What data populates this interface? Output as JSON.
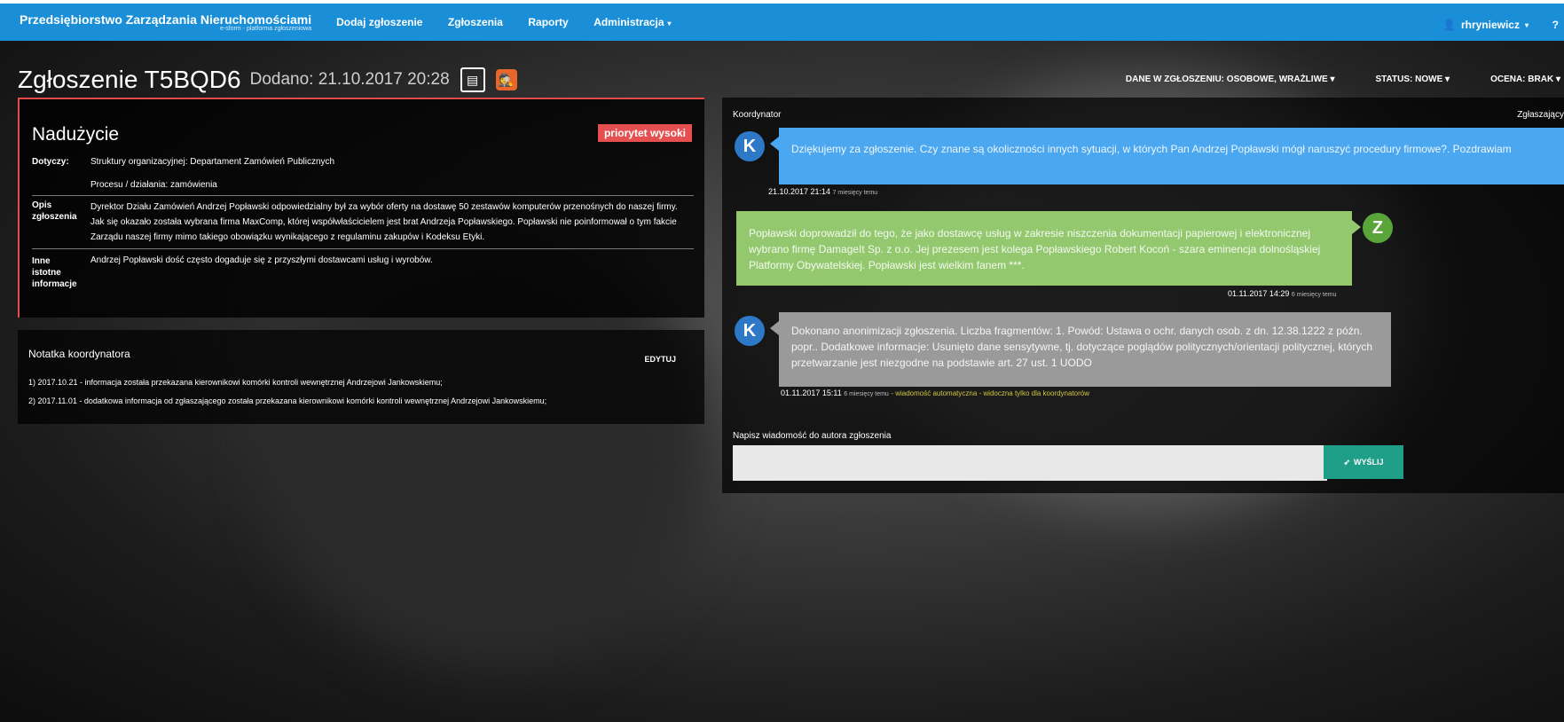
{
  "nav": {
    "brand_title": "Przedsiębiorstwo Zarządzania Nieruchomościami",
    "brand_sub": "e-sform - platforma zgłoszeniowa",
    "items": [
      "Dodaj zgłoszenie",
      "Zgłoszenia",
      "Raporty",
      "Administracja"
    ],
    "user": "rhryniewicz",
    "help": "?"
  },
  "header": {
    "title": "Zgłoszenie T5BQD6",
    "added": "Dodano: 21.10.2017 20:28",
    "data_label": "DANE W ZGŁOSZENIU:",
    "data_value": "OSOBOWE, WRAŻLIWE",
    "status_label": "STATUS:",
    "status_value": "NOWE",
    "rating_label": "OCENA:",
    "rating_value": "BRAK"
  },
  "case": {
    "category": "Nadużycie",
    "priority": "priorytet wysoki",
    "concerns_label": "Dotyczy:",
    "structure": "Struktury organizacyjnej:  Departament Zamówień Publicznych",
    "process": "Procesu / działania:  zamówienia",
    "desc_label_1": "Opis",
    "desc_label_2": "zgłoszenia",
    "description": "Dyrektor Działu Zamówień Andrzej Popławski odpowiedzialny był za wybór oferty na dostawę 50 zestawów komputerów przenośnych do naszej firmy. Jak się okazało została wybrana firma MaxComp, której współwłaścicielem jest brat Andrzeja Popławskiego. Popławski nie poinformował o tym fakcie Zarządu naszej firmy mimo takiego obowiązku wynikającego z regulaminu zakupów i Kodeksu Etyki.",
    "other_label_1": "Inne",
    "other_label_2": "istotne",
    "other_label_3": "informacje",
    "other": "Andrzej Popławski dość często dogaduje się z przyszłymi dostawcami usług i wyrobów."
  },
  "note": {
    "title": "Notatka koordynatora",
    "edit": "EDYTUJ",
    "lines": [
      "1) 2017.10.21 - informacja została przekazana kierownikowi komórki kontroli wewnętrznej Andrzejowi Jankowskiemu;",
      "2) 2017.11.01 - dodatkowa informacja od zgłaszającego została przekazana kierownikowi komórki kontroli wewnętrznej Andrzejowi Jankowskiemu;"
    ]
  },
  "chat": {
    "left_label": "Koordynator",
    "right_label": "Zgłaszający",
    "messages": [
      {
        "avatar": "K",
        "text": "Dziękujemy za zgłoszenie. Czy znane są okoliczności innych sytuacji, w których Pan Andrzej Popławski mógł naruszyć procedury firmowe?. Pozdrawiam",
        "date": "21.10.2017 21:14",
        "ago": "7 miesięcy temu"
      },
      {
        "avatar": "Z",
        "text": "Popławski doprowadził do tego, że jako dostawcę usług w zakresie niszczenia dokumentacji papierowej i elektronicznej wybrano firmę DamageIt Sp. z o.o. Jej prezesem jest kolega Popławskiego Robert Kocoń - szara eminencja dolnośląskiej Platformy Obywatelskiej. Popławski jest wielkim fanem ***.",
        "date": "01.11.2017 14:29",
        "ago": "6 miesięcy temu"
      },
      {
        "avatar": "K",
        "text": "Dokonano anonimizacji zgłoszenia. Liczba fragmentów: 1. Powód: Ustawa o ochr. danych osob. z dn. 12.38.1222 z późn. popr.. Dodatkowe informacje: Usunięto dane sensytywne, tj. dotyczące poglądów politycznych/orientacji politycznej, których przetwarzanie jest niezgodne na podstawie art. 27 ust. 1 UODO",
        "date": "01.11.2017 15:11",
        "ago": "6 miesięcy temu",
        "auto": "- wiadomość automatyczna - widoczna tylko dla koordynatorów"
      }
    ],
    "compose_label": "Napisz wiadomość do autora zgłoszenia",
    "compose_placeholder": "",
    "send": "WYŚLIJ"
  }
}
